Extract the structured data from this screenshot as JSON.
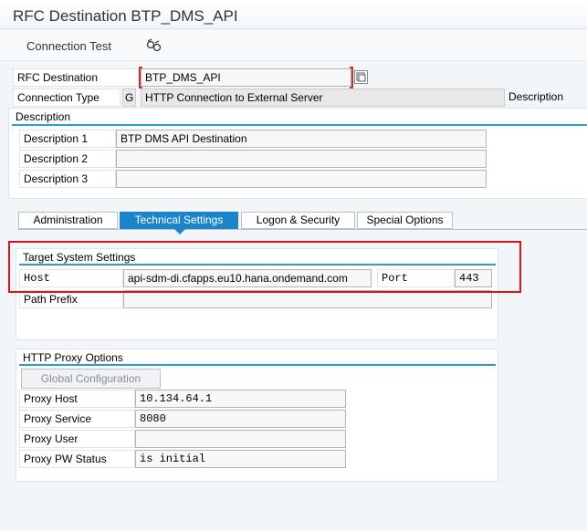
{
  "window": {
    "title": "RFC Destination BTP_DMS_API"
  },
  "toolbar": {
    "connection_test_label": "Connection Test"
  },
  "header": {
    "rfc_destination_label": "RFC Destination",
    "rfc_destination_value": "BTP_DMS_API",
    "connection_type_label": "Connection Type",
    "connection_type_code": "G",
    "connection_type_desc": "HTTP Connection to External Server",
    "description_label": "Description"
  },
  "description": {
    "title": "Description",
    "rows": [
      {
        "label": "Description 1",
        "value": "BTP DMS API Destination"
      },
      {
        "label": "Description 2",
        "value": ""
      },
      {
        "label": "Description 3",
        "value": ""
      }
    ]
  },
  "tabs": [
    {
      "label": "Administration",
      "active": false
    },
    {
      "label": "Technical Settings",
      "active": true
    },
    {
      "label": "Logon & Security",
      "active": false
    },
    {
      "label": "Special Options",
      "active": false
    }
  ],
  "target": {
    "title": "Target System Settings",
    "host_label": "Host",
    "host_value": "api-sdm-di.cfapps.eu10.hana.ondemand.com",
    "port_label": "Port",
    "port_value": "443",
    "path_prefix_label": "Path Prefix",
    "path_prefix_value": ""
  },
  "proxy": {
    "title": "HTTP Proxy Options",
    "global_config_label": "Global Configuration",
    "rows": [
      {
        "label": "Proxy Host",
        "value": "10.134.64.1"
      },
      {
        "label": "Proxy Service",
        "value": "8080"
      },
      {
        "label": "Proxy User",
        "value": ""
      },
      {
        "label": "Proxy PW Status",
        "value": "is initial"
      }
    ]
  },
  "colors": {
    "accent": "#1a86c9",
    "highlight": "#d9141a"
  }
}
